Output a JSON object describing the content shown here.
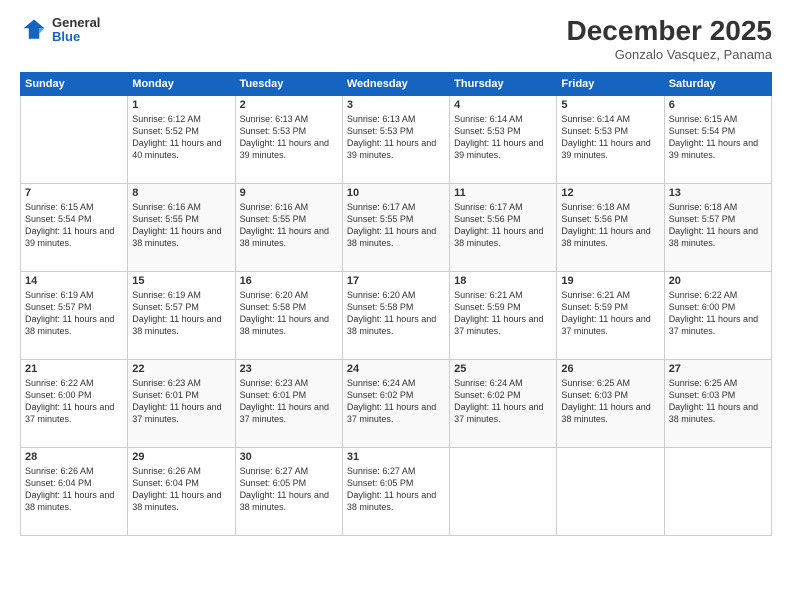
{
  "logo": {
    "general": "General",
    "blue": "Blue"
  },
  "header": {
    "month": "December 2025",
    "location": "Gonzalo Vasquez, Panama"
  },
  "weekdays": [
    "Sunday",
    "Monday",
    "Tuesday",
    "Wednesday",
    "Thursday",
    "Friday",
    "Saturday"
  ],
  "weeks": [
    [
      {
        "day": "",
        "sunrise": "",
        "sunset": "",
        "daylight": ""
      },
      {
        "day": "1",
        "sunrise": "Sunrise: 6:12 AM",
        "sunset": "Sunset: 5:52 PM",
        "daylight": "Daylight: 11 hours and 40 minutes."
      },
      {
        "day": "2",
        "sunrise": "Sunrise: 6:13 AM",
        "sunset": "Sunset: 5:53 PM",
        "daylight": "Daylight: 11 hours and 39 minutes."
      },
      {
        "day": "3",
        "sunrise": "Sunrise: 6:13 AM",
        "sunset": "Sunset: 5:53 PM",
        "daylight": "Daylight: 11 hours and 39 minutes."
      },
      {
        "day": "4",
        "sunrise": "Sunrise: 6:14 AM",
        "sunset": "Sunset: 5:53 PM",
        "daylight": "Daylight: 11 hours and 39 minutes."
      },
      {
        "day": "5",
        "sunrise": "Sunrise: 6:14 AM",
        "sunset": "Sunset: 5:53 PM",
        "daylight": "Daylight: 11 hours and 39 minutes."
      },
      {
        "day": "6",
        "sunrise": "Sunrise: 6:15 AM",
        "sunset": "Sunset: 5:54 PM",
        "daylight": "Daylight: 11 hours and 39 minutes."
      }
    ],
    [
      {
        "day": "7",
        "sunrise": "Sunrise: 6:15 AM",
        "sunset": "Sunset: 5:54 PM",
        "daylight": "Daylight: 11 hours and 39 minutes."
      },
      {
        "day": "8",
        "sunrise": "Sunrise: 6:16 AM",
        "sunset": "Sunset: 5:55 PM",
        "daylight": "Daylight: 11 hours and 38 minutes."
      },
      {
        "day": "9",
        "sunrise": "Sunrise: 6:16 AM",
        "sunset": "Sunset: 5:55 PM",
        "daylight": "Daylight: 11 hours and 38 minutes."
      },
      {
        "day": "10",
        "sunrise": "Sunrise: 6:17 AM",
        "sunset": "Sunset: 5:55 PM",
        "daylight": "Daylight: 11 hours and 38 minutes."
      },
      {
        "day": "11",
        "sunrise": "Sunrise: 6:17 AM",
        "sunset": "Sunset: 5:56 PM",
        "daylight": "Daylight: 11 hours and 38 minutes."
      },
      {
        "day": "12",
        "sunrise": "Sunrise: 6:18 AM",
        "sunset": "Sunset: 5:56 PM",
        "daylight": "Daylight: 11 hours and 38 minutes."
      },
      {
        "day": "13",
        "sunrise": "Sunrise: 6:18 AM",
        "sunset": "Sunset: 5:57 PM",
        "daylight": "Daylight: 11 hours and 38 minutes."
      }
    ],
    [
      {
        "day": "14",
        "sunrise": "Sunrise: 6:19 AM",
        "sunset": "Sunset: 5:57 PM",
        "daylight": "Daylight: 11 hours and 38 minutes."
      },
      {
        "day": "15",
        "sunrise": "Sunrise: 6:19 AM",
        "sunset": "Sunset: 5:57 PM",
        "daylight": "Daylight: 11 hours and 38 minutes."
      },
      {
        "day": "16",
        "sunrise": "Sunrise: 6:20 AM",
        "sunset": "Sunset: 5:58 PM",
        "daylight": "Daylight: 11 hours and 38 minutes."
      },
      {
        "day": "17",
        "sunrise": "Sunrise: 6:20 AM",
        "sunset": "Sunset: 5:58 PM",
        "daylight": "Daylight: 11 hours and 38 minutes."
      },
      {
        "day": "18",
        "sunrise": "Sunrise: 6:21 AM",
        "sunset": "Sunset: 5:59 PM",
        "daylight": "Daylight: 11 hours and 37 minutes."
      },
      {
        "day": "19",
        "sunrise": "Sunrise: 6:21 AM",
        "sunset": "Sunset: 5:59 PM",
        "daylight": "Daylight: 11 hours and 37 minutes."
      },
      {
        "day": "20",
        "sunrise": "Sunrise: 6:22 AM",
        "sunset": "Sunset: 6:00 PM",
        "daylight": "Daylight: 11 hours and 37 minutes."
      }
    ],
    [
      {
        "day": "21",
        "sunrise": "Sunrise: 6:22 AM",
        "sunset": "Sunset: 6:00 PM",
        "daylight": "Daylight: 11 hours and 37 minutes."
      },
      {
        "day": "22",
        "sunrise": "Sunrise: 6:23 AM",
        "sunset": "Sunset: 6:01 PM",
        "daylight": "Daylight: 11 hours and 37 minutes."
      },
      {
        "day": "23",
        "sunrise": "Sunrise: 6:23 AM",
        "sunset": "Sunset: 6:01 PM",
        "daylight": "Daylight: 11 hours and 37 minutes."
      },
      {
        "day": "24",
        "sunrise": "Sunrise: 6:24 AM",
        "sunset": "Sunset: 6:02 PM",
        "daylight": "Daylight: 11 hours and 37 minutes."
      },
      {
        "day": "25",
        "sunrise": "Sunrise: 6:24 AM",
        "sunset": "Sunset: 6:02 PM",
        "daylight": "Daylight: 11 hours and 37 minutes."
      },
      {
        "day": "26",
        "sunrise": "Sunrise: 6:25 AM",
        "sunset": "Sunset: 6:03 PM",
        "daylight": "Daylight: 11 hours and 38 minutes."
      },
      {
        "day": "27",
        "sunrise": "Sunrise: 6:25 AM",
        "sunset": "Sunset: 6:03 PM",
        "daylight": "Daylight: 11 hours and 38 minutes."
      }
    ],
    [
      {
        "day": "28",
        "sunrise": "Sunrise: 6:26 AM",
        "sunset": "Sunset: 6:04 PM",
        "daylight": "Daylight: 11 hours and 38 minutes."
      },
      {
        "day": "29",
        "sunrise": "Sunrise: 6:26 AM",
        "sunset": "Sunset: 6:04 PM",
        "daylight": "Daylight: 11 hours and 38 minutes."
      },
      {
        "day": "30",
        "sunrise": "Sunrise: 6:27 AM",
        "sunset": "Sunset: 6:05 PM",
        "daylight": "Daylight: 11 hours and 38 minutes."
      },
      {
        "day": "31",
        "sunrise": "Sunrise: 6:27 AM",
        "sunset": "Sunset: 6:05 PM",
        "daylight": "Daylight: 11 hours and 38 minutes."
      },
      {
        "day": "",
        "sunrise": "",
        "sunset": "",
        "daylight": ""
      },
      {
        "day": "",
        "sunrise": "",
        "sunset": "",
        "daylight": ""
      },
      {
        "day": "",
        "sunrise": "",
        "sunset": "",
        "daylight": ""
      }
    ]
  ]
}
